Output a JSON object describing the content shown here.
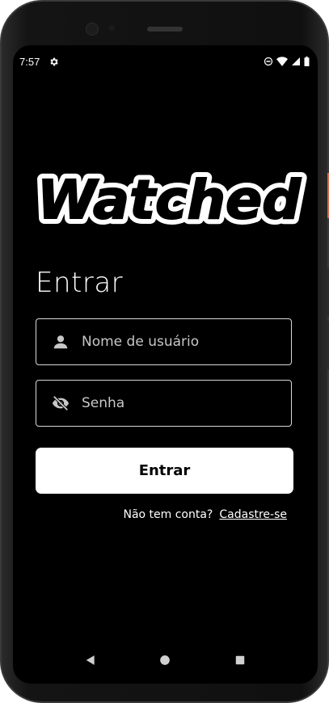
{
  "status_bar": {
    "time": "7:57",
    "icons": [
      "gear-icon",
      "do-not-disturb-icon",
      "wifi-icon",
      "signal-icon",
      "battery-icon"
    ]
  },
  "app": {
    "logo_text": "Watched"
  },
  "login": {
    "title": "Entrar",
    "username_placeholder": "Nome de usuário",
    "password_placeholder": "Senha",
    "submit_label": "Entrar",
    "no_account_text": "Não tem conta?",
    "signup_link": "Cadastre-se"
  },
  "navigation": {
    "back": "back-icon",
    "home": "home-icon",
    "recents": "recents-icon"
  }
}
